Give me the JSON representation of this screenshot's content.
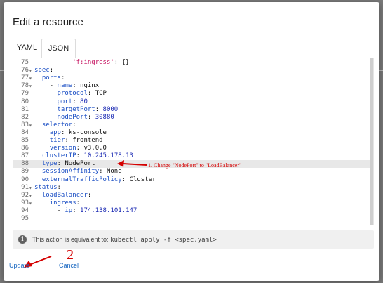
{
  "dialog": {
    "title": "Edit a resource",
    "tabs": [
      {
        "label": "YAML",
        "active": false
      },
      {
        "label": "JSON",
        "active": true
      }
    ]
  },
  "editor": {
    "highlighted_line": 88,
    "lines": [
      {
        "num": "75",
        "fold": "",
        "indent": "          ",
        "parts": [
          {
            "c": "s",
            "v": "'f:ingress'"
          },
          {
            "c": "t",
            "v": ": {}"
          }
        ]
      },
      {
        "num": "76",
        "fold": "▾",
        "indent": "",
        "parts": [
          {
            "c": "k",
            "v": "spec"
          },
          {
            "c": "t",
            "v": ":"
          }
        ]
      },
      {
        "num": "77",
        "fold": "▾",
        "indent": "  ",
        "parts": [
          {
            "c": "k",
            "v": "ports"
          },
          {
            "c": "t",
            "v": ":"
          }
        ]
      },
      {
        "num": "78",
        "fold": "▾",
        "indent": "    ",
        "parts": [
          {
            "c": "t",
            "v": "- "
          },
          {
            "c": "k",
            "v": "name"
          },
          {
            "c": "t",
            "v": ": nginx"
          }
        ]
      },
      {
        "num": "79",
        "fold": "",
        "indent": "      ",
        "parts": [
          {
            "c": "k",
            "v": "protocol"
          },
          {
            "c": "t",
            "v": ": TCP"
          }
        ]
      },
      {
        "num": "80",
        "fold": "",
        "indent": "      ",
        "parts": [
          {
            "c": "k",
            "v": "port"
          },
          {
            "c": "t",
            "v": ": "
          },
          {
            "c": "n",
            "v": "80"
          }
        ]
      },
      {
        "num": "81",
        "fold": "",
        "indent": "      ",
        "parts": [
          {
            "c": "k",
            "v": "targetPort"
          },
          {
            "c": "t",
            "v": ": "
          },
          {
            "c": "n",
            "v": "8000"
          }
        ]
      },
      {
        "num": "82",
        "fold": "",
        "indent": "      ",
        "parts": [
          {
            "c": "k",
            "v": "nodePort"
          },
          {
            "c": "t",
            "v": ": "
          },
          {
            "c": "n",
            "v": "30880"
          }
        ]
      },
      {
        "num": "83",
        "fold": "▾",
        "indent": "  ",
        "parts": [
          {
            "c": "k",
            "v": "selector"
          },
          {
            "c": "t",
            "v": ":"
          }
        ]
      },
      {
        "num": "84",
        "fold": "",
        "indent": "    ",
        "parts": [
          {
            "c": "k",
            "v": "app"
          },
          {
            "c": "t",
            "v": ": ks-console"
          }
        ]
      },
      {
        "num": "85",
        "fold": "",
        "indent": "    ",
        "parts": [
          {
            "c": "k",
            "v": "tier"
          },
          {
            "c": "t",
            "v": ": frontend"
          }
        ]
      },
      {
        "num": "86",
        "fold": "",
        "indent": "    ",
        "parts": [
          {
            "c": "k",
            "v": "version"
          },
          {
            "c": "t",
            "v": ": v3.0.0"
          }
        ]
      },
      {
        "num": "87",
        "fold": "",
        "indent": "  ",
        "parts": [
          {
            "c": "k",
            "v": "clusterIP"
          },
          {
            "c": "t",
            "v": ": "
          },
          {
            "c": "n",
            "v": "10.245.178.13"
          }
        ]
      },
      {
        "num": "88",
        "fold": "",
        "indent": "  ",
        "parts": [
          {
            "c": "k",
            "v": "type"
          },
          {
            "c": "t",
            "v": ": NodePort"
          }
        ]
      },
      {
        "num": "89",
        "fold": "",
        "indent": "  ",
        "parts": [
          {
            "c": "k",
            "v": "sessionAffinity"
          },
          {
            "c": "t",
            "v": ": None"
          }
        ]
      },
      {
        "num": "90",
        "fold": "",
        "indent": "  ",
        "parts": [
          {
            "c": "k",
            "v": "externalTrafficPolicy"
          },
          {
            "c": "t",
            "v": ": Cluster"
          }
        ]
      },
      {
        "num": "91",
        "fold": "▾",
        "indent": "",
        "parts": [
          {
            "c": "k",
            "v": "status"
          },
          {
            "c": "t",
            "v": ":"
          }
        ]
      },
      {
        "num": "92",
        "fold": "▾",
        "indent": "  ",
        "parts": [
          {
            "c": "k",
            "v": "loadBalancer"
          },
          {
            "c": "t",
            "v": ":"
          }
        ]
      },
      {
        "num": "93",
        "fold": "▾",
        "indent": "    ",
        "parts": [
          {
            "c": "k",
            "v": "ingress"
          },
          {
            "c": "t",
            "v": ":"
          }
        ]
      },
      {
        "num": "94",
        "fold": "",
        "indent": "      ",
        "parts": [
          {
            "c": "t",
            "v": "- "
          },
          {
            "c": "k",
            "v": "ip"
          },
          {
            "c": "t",
            "v": ": "
          },
          {
            "c": "n",
            "v": "174.138.101.147"
          }
        ]
      },
      {
        "num": "95",
        "fold": "",
        "indent": "",
        "parts": []
      }
    ]
  },
  "annotations": {
    "step1": "1. Change \"NodePort\" to \"LoadBalancer\"",
    "step2": "2"
  },
  "info": {
    "icon": "info-icon",
    "text": "This action is equivalent to:",
    "command": "kubectl apply -f <spec.yaml>"
  },
  "actions": {
    "update_label": "Update",
    "cancel_label": "Cancel"
  },
  "colors": {
    "key": "#1a4ec4",
    "string": "#c5105e",
    "number": "#1b2ab3",
    "link": "#1565c0",
    "annotation": "#d40000"
  }
}
